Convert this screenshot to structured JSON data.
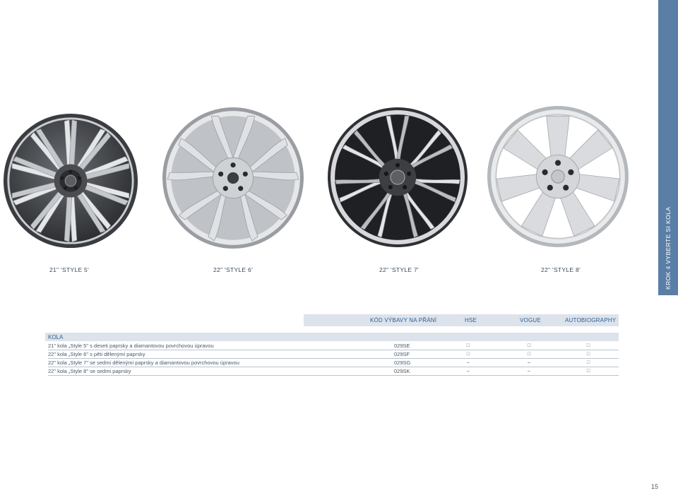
{
  "side_tab": {
    "label": "KROK 4 VYBERTE SI KOLA"
  },
  "wheels": [
    {
      "caption": "21\" 'STYLE 5'"
    },
    {
      "caption": "22\" 'STYLE 6'"
    },
    {
      "caption": "22\" 'STYLE 7'"
    },
    {
      "caption": "22\" 'STYLE 8'"
    }
  ],
  "table": {
    "headers": {
      "code": "KÓD VÝBAVY NA PŘÁNÍ",
      "hse": "HSE",
      "vogue": "VOGUE",
      "autobiography": "AUTOBIOGRAPHY"
    },
    "section": "KOLA",
    "rows": [
      {
        "desc": "21\" kola „Style 5\" s deseti paprsky a diamantovou povrchovou úpravou",
        "code": "029SE",
        "hse": "□",
        "vogue": "□",
        "autobiography": "□"
      },
      {
        "desc": "22\" kola „Style 6\" s pěti dělenými paprsky",
        "code": "029SF",
        "hse": "□",
        "vogue": "□",
        "autobiography": "□"
      },
      {
        "desc": "22\" kola „Style 7\" se sedmi dělenými paprsky a diamantovou povrchovou úpravou",
        "code": "029SG",
        "hse": "–",
        "vogue": "–",
        "autobiography": "□"
      },
      {
        "desc": "22\" kola „Style 8\" se sedmi paprsky",
        "code": "029SK",
        "hse": "–",
        "vogue": "–",
        "autobiography": "□"
      }
    ]
  },
  "page_number": "15",
  "colors": {
    "accent": "#5a7ea6",
    "header_bg": "#dce3eb",
    "header_text": "#2f5f93"
  }
}
